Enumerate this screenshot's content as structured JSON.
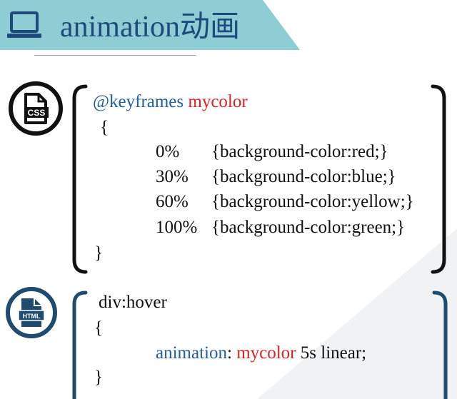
{
  "header": {
    "title": "animation动画",
    "band_color": "#8ecdd3",
    "icon": "laptop-icon"
  },
  "colors": {
    "keyword": "#1f5f9e",
    "name": "#e02020",
    "text": "#111111",
    "css_bracket": "#111111",
    "html_bracket": "#1e4b6e"
  },
  "css_block": {
    "icon": "css-file-icon",
    "icon_label": "CSS",
    "at_rule": "@keyframes",
    "animation_name": "mycolor",
    "open_brace": "{",
    "close_brace": "}",
    "steps": [
      {
        "percent": "0%",
        "rule": "{background-color:red;}"
      },
      {
        "percent": "30%",
        "rule": "{background-color:blue;}"
      },
      {
        "percent": "60%",
        "rule": "{background-color:yellow;}"
      },
      {
        "percent": "100%",
        "rule": "{background-color:green;}"
      }
    ]
  },
  "html_block": {
    "icon": "html-file-icon",
    "icon_label": "HTML",
    "selector": "div:hover",
    "open_brace": "{",
    "close_brace": "}",
    "property": "animation",
    "colon": ":",
    "value_name": "mycolor",
    "value_rest": "5s linear;"
  }
}
